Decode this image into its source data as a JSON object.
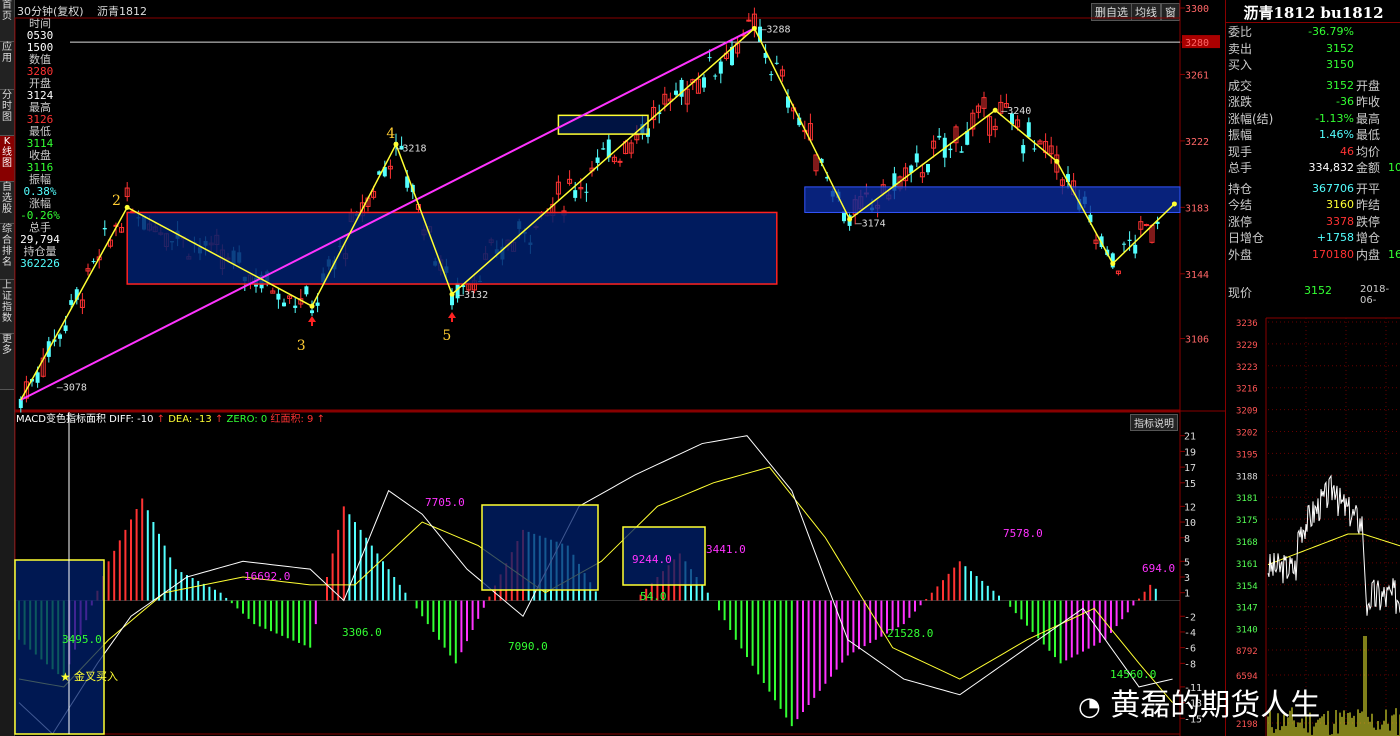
{
  "topbar": {
    "period": "30分钟(复权)",
    "symbol": "沥青1812",
    "btn_del": "删自选",
    "btn_ma": "均线",
    "btn_win": "窗"
  },
  "lefttabs": [
    "首页",
    "应用",
    "分时图",
    "K线图",
    "自选股",
    "综合排名",
    "上证指数",
    "更多"
  ],
  "info": {
    "time_label": "时间",
    "time_v1": "0530",
    "time_v2": "1500",
    "val_label": "数值",
    "val": "3280",
    "open_label": "开盘",
    "open": "3124",
    "high_label": "最高",
    "high": "3126",
    "low_label": "最低",
    "low": "3114",
    "close_label": "收盘",
    "close": "3116",
    "amp_label": "振幅",
    "amp": "0.38%",
    "chg_label": "涨幅",
    "chg": "-0.26%",
    "vol_label": "总手",
    "vol": "29,794",
    "oi_label": "持仓量",
    "oi": "362226"
  },
  "macd_header": {
    "name": "MACD变色指标面积",
    "diff": "DIFF: -10",
    "dea": "DEA: -13",
    "zero": "ZERO: 0",
    "red": "红面积: 9",
    "explain": "指标说明"
  },
  "colors": {
    "up": "#ff3333",
    "down": "#54ffff",
    "yellow": "#ffff33",
    "magenta": "#ff33ff",
    "green": "#33ff33",
    "white": "#ffffff",
    "blue": "#00206e",
    "red_border": "#ff2222"
  },
  "chart_data": [
    {
      "type": "candlestick",
      "ylim": [
        3067,
        3300
      ],
      "price_ticks": [
        "3300",
        "3280",
        "3261",
        "3222",
        "3183",
        "3144",
        "3106"
      ],
      "current_marker": "3280",
      "wave_labels": [
        "2",
        "3",
        "4",
        "5"
      ],
      "price_labels": [
        "3078",
        "3218",
        "3132",
        "3288",
        "3174",
        "3240"
      ],
      "zigzag": [
        [
          0,
          3070
        ],
        [
          19,
          3183
        ],
        [
          52,
          3125
        ],
        [
          67,
          3220
        ],
        [
          77,
          3132
        ],
        [
          131,
          3288
        ],
        [
          148,
          3176
        ],
        [
          174,
          3240
        ],
        [
          185,
          3210
        ],
        [
          195,
          3150
        ],
        [
          206,
          3185
        ]
      ],
      "boxes": [
        {
          "x0": 19,
          "x1": 135,
          "y0": 3180,
          "y1": 3138,
          "style": "red"
        },
        {
          "x0": 96,
          "x1": 112,
          "y0": 3237,
          "y1": 3226,
          "style": "yellow"
        },
        {
          "x0": 140,
          "x1": 207,
          "y0": 3195,
          "y1": 3180,
          "style": "blue"
        }
      ]
    },
    {
      "type": "macd",
      "ylim": [
        -17,
        23
      ],
      "y_ticks": [
        "21",
        "19",
        "17",
        "15",
        "12",
        "10",
        "8",
        "5",
        "3",
        "1",
        "-2",
        "-4",
        "-6",
        "-8",
        "-11",
        "-13",
        "-15"
      ],
      "area_labels": [
        "3495.0",
        "16692.0",
        "3306.0",
        "7705.0",
        "7090.0",
        "9244.0",
        "54.0",
        "3441.0",
        "21528.0",
        "7578.0",
        "694.0",
        "14560.0"
      ],
      "annotation": "金叉买入"
    }
  ],
  "right": {
    "title": "沥青1812 bu1812",
    "rows": [
      {
        "l": "委比",
        "v": "-36.79%",
        "c": "#33ff33"
      },
      {
        "l": "卖出",
        "v": "3152",
        "c": "#33ff33"
      },
      {
        "l": "买入",
        "v": "3150",
        "c": "#33ff33"
      },
      {
        "l": "成交",
        "v": "3152",
        "c": "#33ff33",
        "l2": "开盘"
      },
      {
        "l": "涨跌",
        "v": "-36",
        "c": "#33ff33",
        "l2": "昨收"
      },
      {
        "l": "涨幅(结)",
        "v": "-1.13%",
        "c": "#33ff33",
        "l2": "最高"
      },
      {
        "l": "振幅",
        "v": "1.46%",
        "c": "#54ffff",
        "l2": "最低"
      },
      {
        "l": "现手",
        "v": "46",
        "c": "#ff3333",
        "l2": "均价"
      },
      {
        "l": "总手",
        "v": "334,832",
        "c": "#ffffff",
        "l2": "金额",
        "v2": "10"
      },
      {
        "l": "持仓",
        "v": "367706",
        "c": "#54ffff",
        "l2": "开平"
      },
      {
        "l": "今结",
        "v": "3160",
        "c": "#ffff33",
        "l2": "昨结"
      },
      {
        "l": "涨停",
        "v": "3378",
        "c": "#ff3333",
        "l2": "跌停"
      },
      {
        "l": "日增仓",
        "v": "+1758",
        "c": "#54ffff",
        "l2": "增仓"
      },
      {
        "l": "外盘",
        "v": "170180",
        "c": "#ff3333",
        "l2": "内盘",
        "v2": "16"
      }
    ],
    "price_label": "现价",
    "price": "3152",
    "date": "2018-06-",
    "tl_ticks": [
      "3236",
      "3229",
      "3223",
      "3216",
      "3209",
      "3202",
      "3195",
      "3188",
      "3181",
      "3175",
      "3168",
      "3161",
      "3154",
      "3147",
      "3140",
      "8792",
      "6594",
      "2198"
    ]
  },
  "watermark": "黄磊的期货人生"
}
